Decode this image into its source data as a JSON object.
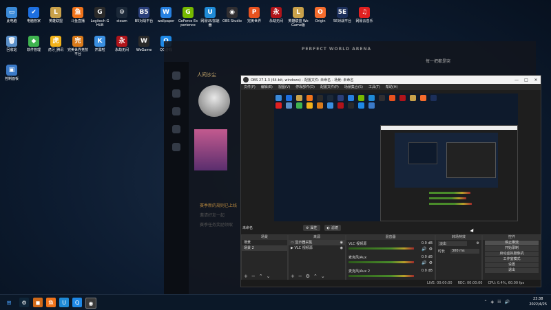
{
  "desktop_row1": [
    {
      "label": "此电脑",
      "color": "#3b8ad8",
      "glyph": "▭"
    },
    {
      "label": "电脑管家",
      "color": "#1d6fe0",
      "glyph": "✔"
    },
    {
      "label": "英雄联盟",
      "color": "#c9a14a",
      "glyph": "L"
    },
    {
      "label": "斗鱼直播",
      "color": "#f0731a",
      "glyph": "鱼"
    },
    {
      "label": "Logitech G HUB",
      "color": "#2a2a2a",
      "glyph": "G"
    },
    {
      "label": "steam",
      "color": "#1b2838",
      "glyph": "⚙"
    },
    {
      "label": "B5对战平台",
      "color": "#2a3f7a",
      "glyph": "B5"
    },
    {
      "label": "wallpaper",
      "color": "#2680e0",
      "glyph": "W"
    },
    {
      "label": "GeForce Experience",
      "color": "#76b900",
      "glyph": "G"
    },
    {
      "label": "网易UU加速器",
      "color": "#1f8ad6",
      "glyph": "U"
    },
    {
      "label": "OBS Studio",
      "color": "#302e31",
      "glyph": "◉"
    },
    {
      "label": "完美世界",
      "color": "#e8521f",
      "glyph": "P"
    },
    {
      "label": "永劫无间",
      "color": "#b0141a",
      "glyph": "永"
    },
    {
      "label": "英雄联盟 WeGame版",
      "color": "#c9a14a",
      "glyph": "L"
    },
    {
      "label": "Origin",
      "color": "#f56c2d",
      "glyph": "O"
    },
    {
      "label": "5E对战平台",
      "color": "#1c2f5a",
      "glyph": "5E"
    },
    {
      "label": "网易云音乐",
      "color": "#e02020",
      "glyph": "♫"
    }
  ],
  "desktop_row2": [
    {
      "label": "回收站",
      "color": "#5a8fc8",
      "glyph": "🗑"
    },
    {
      "label": "软件管理",
      "color": "#3fb34f",
      "glyph": "◆"
    },
    {
      "label": "虎牙_腾讯",
      "color": "#f2b21a",
      "glyph": "虎"
    },
    {
      "label": "完美世界竞技平台",
      "color": "#d97a1a",
      "glyph": "完"
    },
    {
      "label": "开黑啦",
      "color": "#3a8fe0",
      "glyph": "K"
    },
    {
      "label": "永劫无间",
      "color": "#b0141a",
      "glyph": "永"
    },
    {
      "label": "WeGame",
      "color": "#2a2a2a",
      "glyph": "W"
    },
    {
      "label": "QQ游戏",
      "color": "#1e88e5",
      "glyph": "Q"
    }
  ],
  "desktop_row3": [
    {
      "label": "控制面板",
      "color": "#3b7ac8",
      "glyph": "▣"
    }
  ],
  "launcher": {
    "title": "PERFECT WORLD ARENA",
    "account": "人间沙尘",
    "user": "每一把都是突",
    "news1": "赛季新的规则已上线",
    "news2": "邀请好友一起",
    "news3": "赛季任务奖励领取"
  },
  "obs": {
    "title": "OBS 27.1.3 (64-bit, windows) - 配置文件: 未命名 - 场景: 未命名",
    "menu": [
      "文件(F)",
      "编辑(E)",
      "视图(V)",
      "停靠部件(D)",
      "配置文件(P)",
      "场景集合(S)",
      "工具(T)",
      "帮助(H)"
    ],
    "current_scene": "未命名",
    "props_btn": "属性",
    "filter_btn": "滤镜",
    "docks": {
      "scenes": "场景",
      "sources": "来源",
      "mixer": "混音器",
      "transitions": "转场特效",
      "controls": "控件"
    },
    "scenes": [
      "场景",
      "场景 2"
    ],
    "sources": [
      "显示器采集",
      "VLC 视频源"
    ],
    "mixer": [
      {
        "name": "VLC 视频源",
        "db": "0.0 dB"
      },
      {
        "name": "麦克风/Aux",
        "db": "0.0 dB"
      },
      {
        "name": "麦克风/Aux 2",
        "db": "0.0 dB"
      }
    ],
    "transition_sel": "淡出",
    "duration_label": "时长",
    "duration": "300 ms",
    "controls": [
      "停止推流",
      "开始录制",
      "启动虚拟摄像机",
      "工作室模式",
      "设置",
      "退出"
    ],
    "status": {
      "live": "LIVE: 00:00:00",
      "rec": "REC: 00:00:00",
      "cpu": "CPU: 0.4%, 60.00 fps"
    }
  },
  "taskbar": {
    "time": "23:38",
    "date": "2022/4/25"
  }
}
